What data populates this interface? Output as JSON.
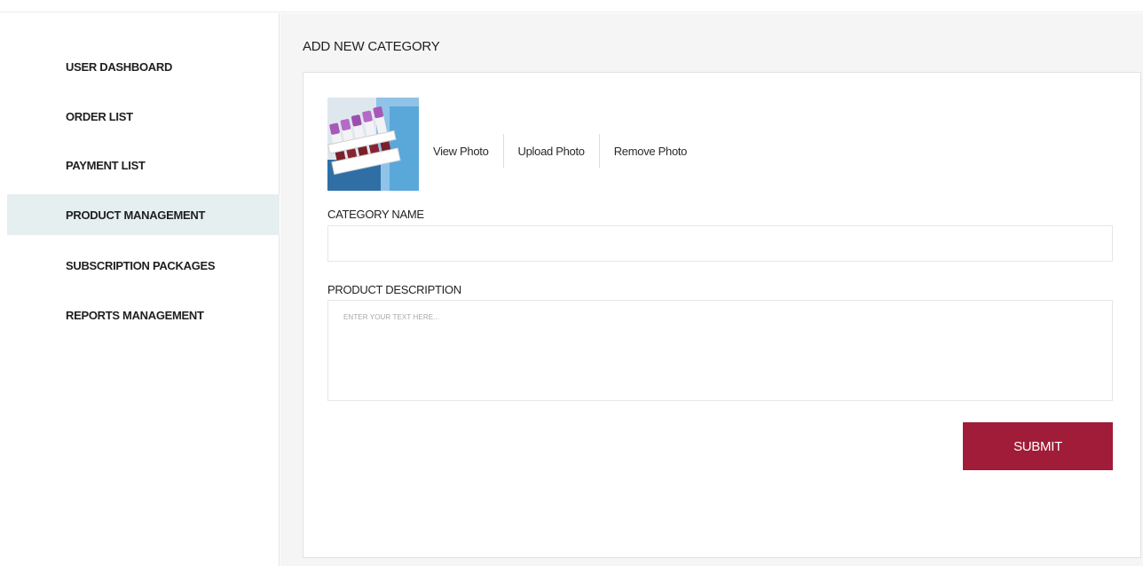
{
  "sidebar": {
    "items": [
      {
        "label": "USER DASHBOARD",
        "active": false
      },
      {
        "label": "ORDER LIST",
        "active": false
      },
      {
        "label": "PAYMENT LIST",
        "active": false
      },
      {
        "label": "PRODUCT MANAGEMENT",
        "active": true
      },
      {
        "label": "SUBSCRIPTION PACKAGES",
        "active": false
      },
      {
        "label": "REPORTS MANAGEMENT",
        "active": false
      }
    ]
  },
  "main": {
    "title": "ADD NEW CATEGORY",
    "photo": {
      "icon": "category-photo-test-tubes",
      "actions": [
        "View Photo",
        "Upload Photo",
        "Remove Photo"
      ]
    },
    "form": {
      "category_name_label": "CATEGORY NAME",
      "category_name_value": "",
      "description_label": "PRODUCT DESCRIPTION",
      "description_placeholder": "ENTER YOUR TEXT HERE...",
      "submit_label": "SUBMIT"
    }
  },
  "colors": {
    "accent": "#a01c38",
    "active_nav_bg": "#e6efef",
    "main_bg": "#f5f5f5"
  }
}
